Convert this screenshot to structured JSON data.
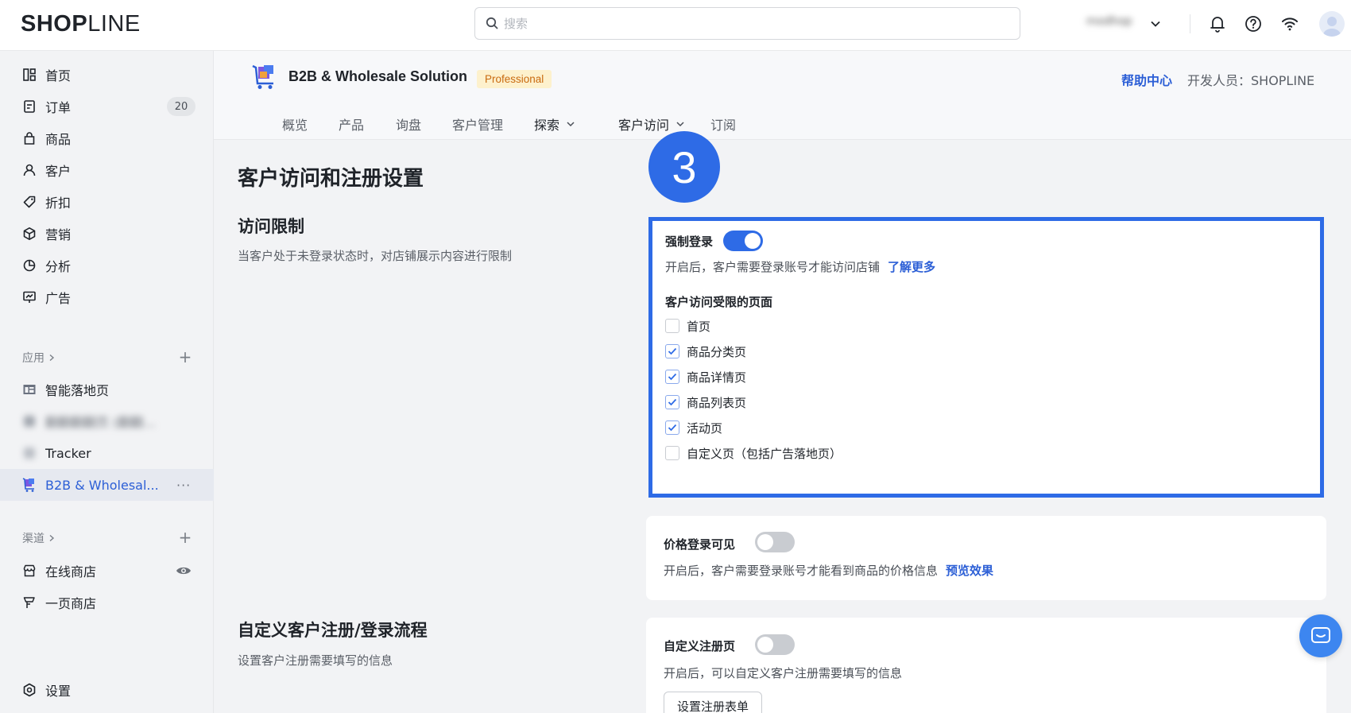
{
  "header": {
    "logo_bold": "SHOP",
    "logo_light": "LINE",
    "search_placeholder": "搜索",
    "store_name": "modhop"
  },
  "sidebar": {
    "items": [
      {
        "label": "首页",
        "icon": "home-icon"
      },
      {
        "label": "订单",
        "icon": "order-icon",
        "badge": "20"
      },
      {
        "label": "商品",
        "icon": "product-icon"
      },
      {
        "label": "客户",
        "icon": "customer-icon"
      },
      {
        "label": "折扣",
        "icon": "tag-icon"
      },
      {
        "label": "营销",
        "icon": "marketing-icon"
      },
      {
        "label": "分析",
        "icon": "analytics-icon"
      },
      {
        "label": "广告",
        "icon": "ads-icon"
      }
    ],
    "apps_title": "应用",
    "apps": [
      {
        "label": "智能落地页"
      },
      {
        "label": "翻翻翻翻页 (翻翻..."
      },
      {
        "label": "Tracker"
      },
      {
        "label": "B2B & Wholesal..."
      }
    ],
    "channels_title": "渠道",
    "channels": [
      {
        "label": "在线商店"
      },
      {
        "label": "一页商店"
      }
    ],
    "settings_label": "设置"
  },
  "app": {
    "name": "B2B & Wholesale Solution",
    "plan_badge": "Professional",
    "help_center": "帮助中心",
    "developer": "开发人员：SHOPLINE",
    "tabs": [
      "概览",
      "产品",
      "询盘",
      "客户管理",
      "探索",
      "客户访问",
      "订阅"
    ]
  },
  "page": {
    "title": "客户访问和注册设置",
    "step_number": "3",
    "access_section": {
      "heading": "访问限制",
      "description": "当客户处于未登录状态时，对店铺展示内容进行限制"
    },
    "force_login": {
      "label": "强制登录",
      "enabled": true,
      "description": "开启后，客户需要登录账号才能访问店铺",
      "link": "了解更多",
      "restricted_title": "客户访问受限的页面",
      "pages": [
        {
          "label": "首页",
          "checked": false
        },
        {
          "label": "商品分类页",
          "checked": true
        },
        {
          "label": "商品详情页",
          "checked": true
        },
        {
          "label": "商品列表页",
          "checked": true
        },
        {
          "label": "活动页",
          "checked": true
        },
        {
          "label": "自定义页（包括广告落地页）",
          "checked": false
        }
      ]
    },
    "price_login": {
      "label": "价格登录可见",
      "enabled": false,
      "description": "开启后，客户需要登录账号才能看到商品的价格信息",
      "link": "预览效果"
    },
    "register_section": {
      "heading": "自定义客户注册/登录流程",
      "description": "设置客户注册需要填写的信息"
    },
    "custom_register": {
      "label": "自定义注册页",
      "enabled": false,
      "description": "开启后，可以自定义客户注册需要填写的信息",
      "button": "设置注册表单"
    }
  },
  "colors": {
    "accent": "#2e6be6",
    "link": "#2c5fd6",
    "badge_bg": "#fdf1cd",
    "badge_text": "#c96a0f"
  }
}
